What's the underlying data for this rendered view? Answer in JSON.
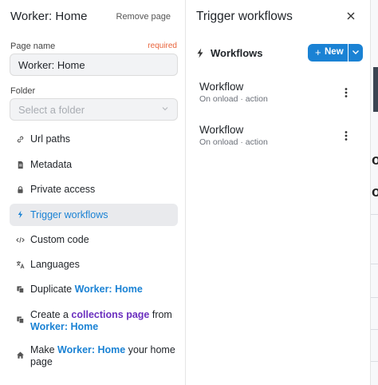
{
  "left_panel": {
    "title": "Worker: Home",
    "remove_page": "Remove page",
    "page_name_label": "Page name",
    "required": "required",
    "page_name_value": "Worker: Home",
    "folder_label": "Folder",
    "folder_placeholder": "Select a folder",
    "menu": {
      "url_paths": "Url paths",
      "metadata": "Metadata",
      "private_access": "Private access",
      "trigger_workflows": "Trigger workflows",
      "custom_code": "Custom code",
      "languages": "Languages",
      "duplicate_prefix": "Duplicate ",
      "duplicate_page": "Worker: Home",
      "create_prefix": "Create a ",
      "create_link": "collections page",
      "create_mid": " from",
      "create_page": "Worker: Home",
      "make_prefix": "Make ",
      "make_page": "Worker: Home",
      "make_suffix": " your home",
      "make_suffix2": "page"
    },
    "active_item": "trigger_workflows"
  },
  "right_panel": {
    "title": "Trigger workflows",
    "section_label": "Workflows",
    "new_button": "New",
    "workflows": [
      {
        "name": "Workflow",
        "subtitle": "On onload · action"
      },
      {
        "name": "Workflow",
        "subtitle": "On onload · action"
      }
    ]
  },
  "edge": {
    "glyph_1": "o·",
    "glyph_2": "o"
  },
  "colors": {
    "accent": "#1a82d4",
    "required": "#e8643c",
    "purple_link": "#6b2fbf",
    "active_bg": "#e9eaed"
  }
}
